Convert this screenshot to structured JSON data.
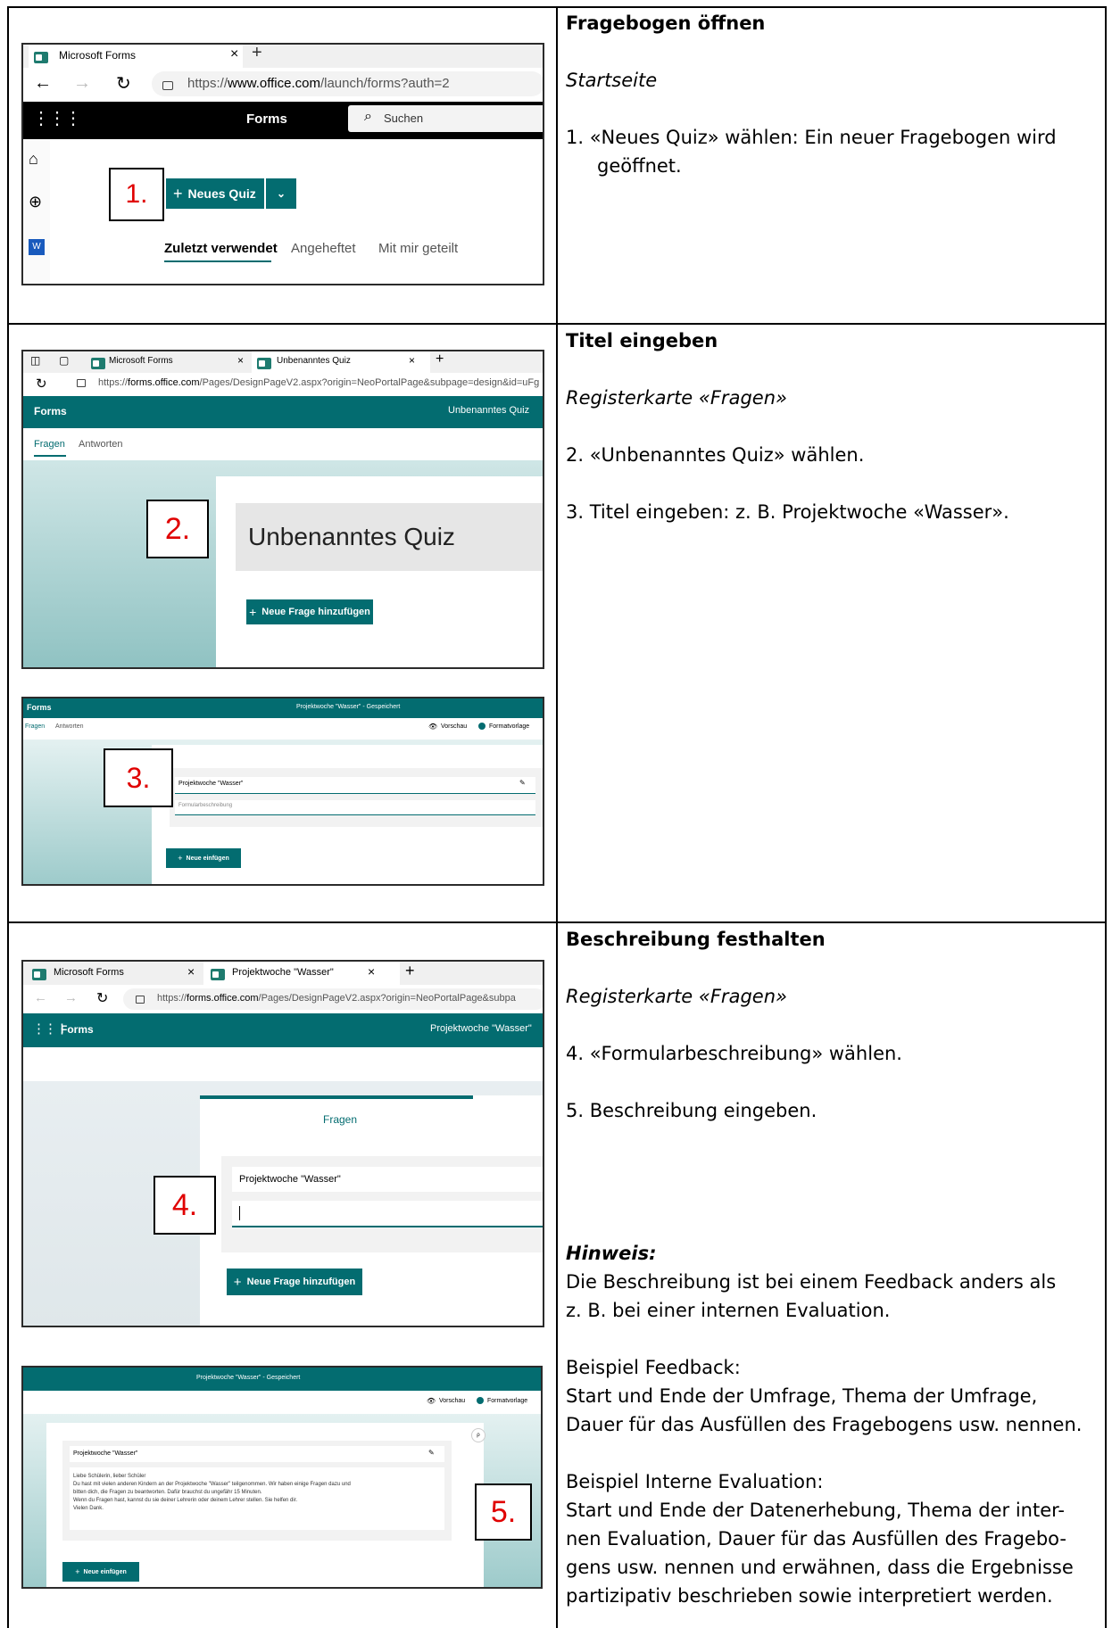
{
  "rows": [
    {
      "heading": "Fragebogen öffnen",
      "context": "Startseite",
      "steps": [
        "1.  «Neues Quiz» wählen: Ein neuer Fragebogen wird",
        "geöffnet."
      ]
    },
    {
      "heading": "Titel eingeben",
      "context": "Registerkarte «Fragen»",
      "steps": [
        "2.  «Unbenanntes Quiz» wählen.",
        "3.  Titel eingeben: z. B. Projektwoche «Wasser»."
      ]
    },
    {
      "heading": "Beschreibung festhalten",
      "context": "Registerkarte «Fragen»",
      "steps": [
        "4.  «Formularbeschreibung» wählen.",
        "5.  Beschreibung eingeben."
      ],
      "note_title": "Hinweis:",
      "note_lines": [
        "Die Beschreibung ist bei einem Feedback anders als",
        "z. B. bei einer internen Evaluation."
      ],
      "feedback_title": "Beispiel Feedback:",
      "feedback_lines": [
        "Start und Ende der Umfrage, Thema der Umfrage,",
        "Dauer für das Ausfüllen des Fragebogens usw. nennen."
      ],
      "internal_title": "Beispiel Interne Evaluation:",
      "internal_lines": [
        "Start und Ende der Datenerhebung, Thema der inter-",
        "nen Evaluation, Dauer für das Ausfüllen des Fragebo-",
        "gens usw. nennen und erwähnen, dass die Ergebnisse",
        "partizipativ beschrieben sowie interpretiert werden."
      ]
    }
  ],
  "shot1": {
    "tab_title": "Microsoft Forms",
    "url_prefix": "https://",
    "url_domain": "www.office.com",
    "url_rest": "/launch/forms?auth=2",
    "app_name": "Forms",
    "search_placeholder": "Suchen",
    "step_label": "1.",
    "new_quiz": "Neues Quiz",
    "tabs": [
      "Zuletzt verwendet",
      "Angeheftet",
      "Mit mir geteilt"
    ]
  },
  "shot2": {
    "tab1": "Microsoft Forms",
    "tab2": "Unbenanntes Quiz",
    "url_prefix": "https://",
    "url_domain": "forms.office.com",
    "url_rest": "/Pages/DesignPageV2.aspx?origin=NeoPortalPage&subpage=design&id=uFg",
    "app_name": "Forms",
    "header_title": "Unbenanntes Quiz",
    "tab_questions": "Fragen",
    "tab_answers": "Antworten",
    "step_label": "2.",
    "quiz_title": "Unbenanntes Quiz",
    "add_question": "Neue Frage hinzufügen"
  },
  "shot3": {
    "app_name": "Forms",
    "header_title": "Projektwoche \"Wasser\"  -  Gespeichert",
    "tab_questions": "Fragen",
    "tab_answers": "Antworten",
    "preview": "Vorschau",
    "theme": "Formatvorlage",
    "step_label": "3.",
    "title_value": "Projektwoche \"Wasser\"",
    "desc_placeholder": "Formularbeschreibung",
    "insert_new": "Neue einfügen"
  },
  "shot4": {
    "tab1": "Microsoft Forms",
    "tab2": "Projektwoche \"Wasser\"",
    "url_prefix": "https://",
    "url_domain": "forms.office.com",
    "url_rest": "/Pages/DesignPageV2.aspx?origin=NeoPortalPage&subpa",
    "app_name": "Forms",
    "header_title": "Projektwoche \"Wasser\"",
    "questions_tab": "Fragen",
    "step_label": "4.",
    "title_value": "Projektwoche \"Wasser\"",
    "add_question": "Neue Frage hinzufügen"
  },
  "shot5": {
    "header_title": "Projektwoche \"Wasser\"  -  Gespeichert",
    "preview": "Vorschau",
    "theme": "Formatvorlage",
    "title_value": "Projektwoche \"Wasser\"",
    "desc_lines": [
      "Liebe Schülerin, lieber Schüler",
      "Du hast mit vielen anderen Kindern an der Projektwoche \"Wasser\" teilgenommen. Wir haben einige Fragen dazu und",
      "bitten dich, die Fragen zu beantworten. Dafür brauchst du ungefähr 15 Minuten.",
      "Wenn du Fragen hast, kannst du sie deiner Lehrerin oder deinem Lehrer stellen. Sie helfen dir.",
      "Vielen Dank."
    ],
    "step_label": "5.",
    "insert_new": "Neue einfügen"
  }
}
